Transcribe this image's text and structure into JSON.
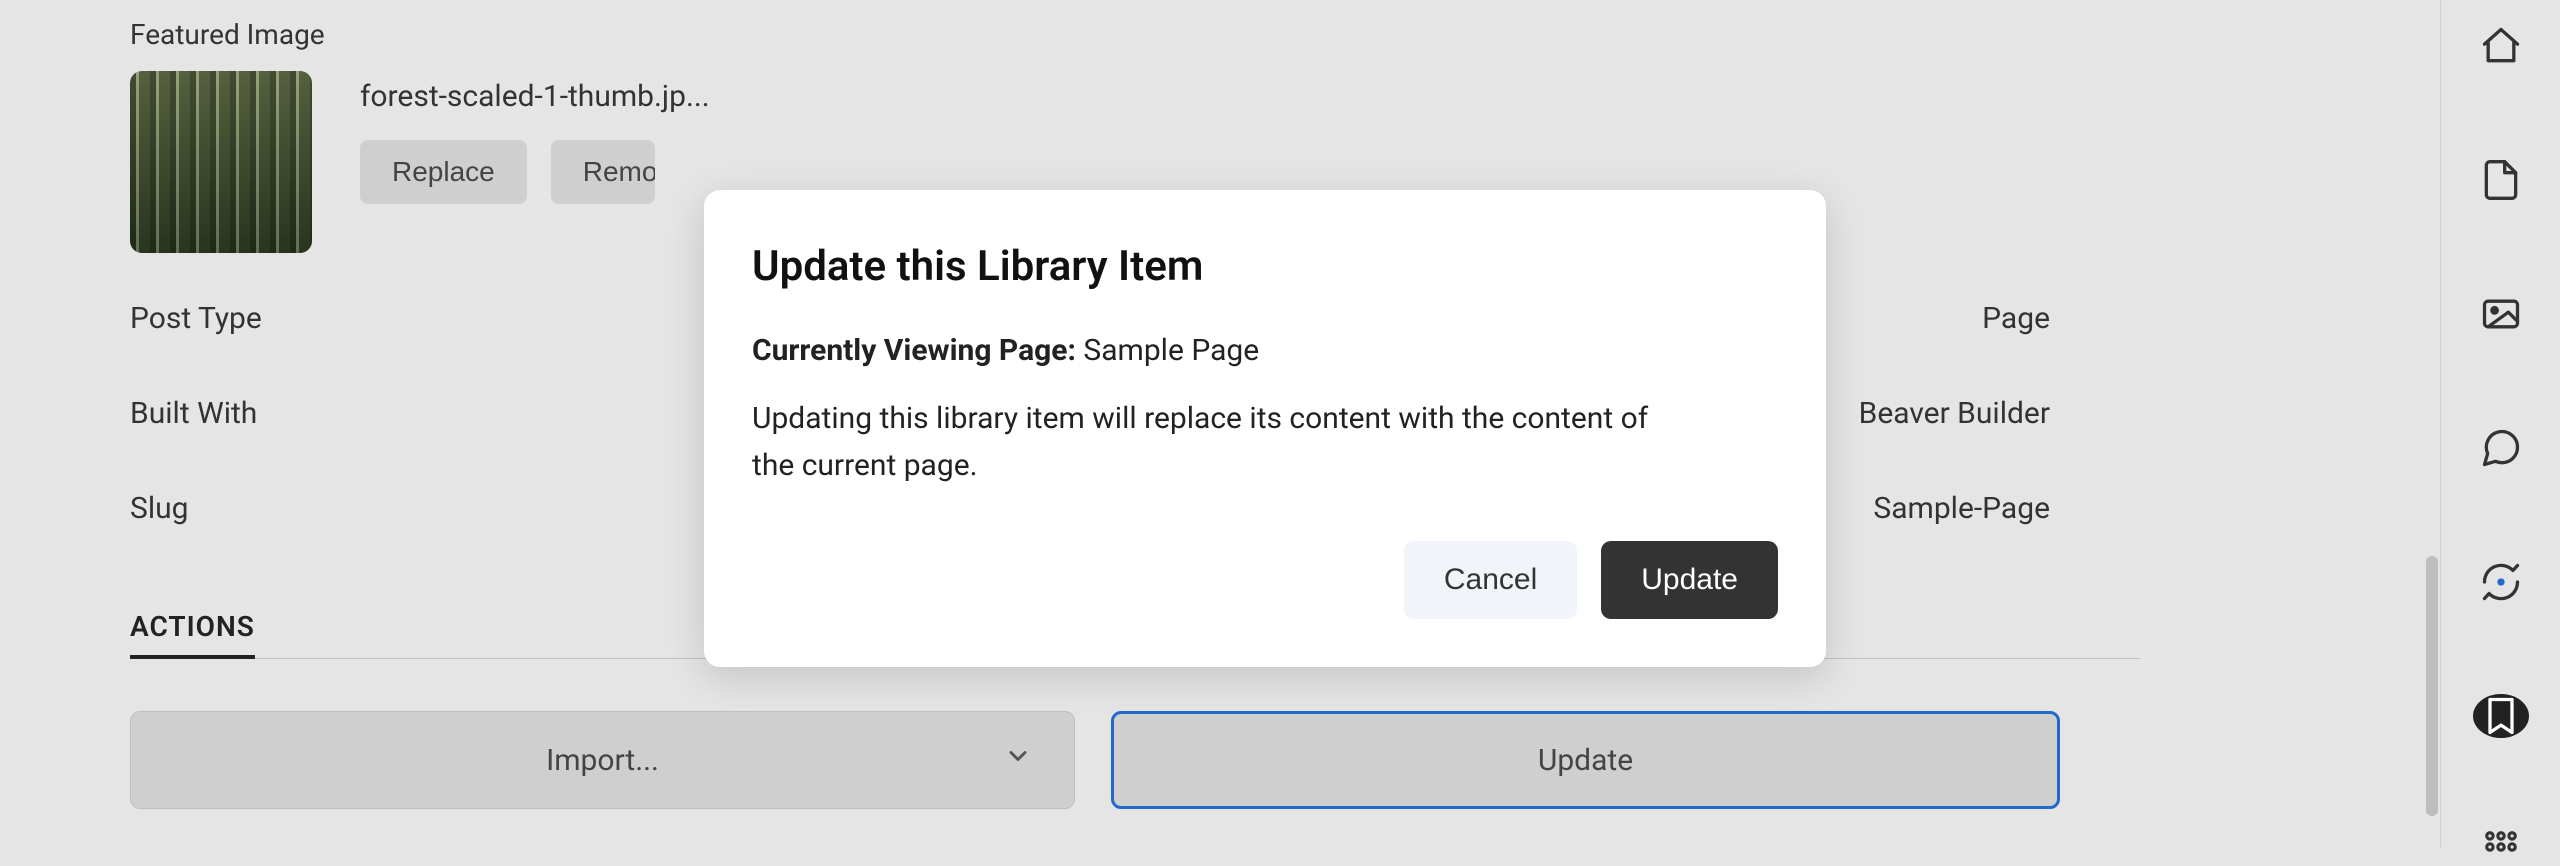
{
  "featured": {
    "section_label": "Featured Image",
    "filename": "forest-scaled-1-thumb.jp...",
    "replace_label": "Replace",
    "remove_label": "Remove"
  },
  "meta": {
    "post_type_label": "Post Type",
    "post_type_value": "Page",
    "built_with_label": "Built With",
    "built_with_value": "Beaver Builder",
    "slug_label": "Slug",
    "slug_value": "Sample-Page"
  },
  "actions": {
    "header": "ACTIONS",
    "import_label": "Import...",
    "update_label": "Update"
  },
  "modal": {
    "title": "Update this Library Item",
    "viewing_label": "Currently Viewing Page:",
    "viewing_value": "Sample Page",
    "body": "Updating this library item will replace its content with the content of the current page.",
    "cancel_label": "Cancel",
    "update_label": "Update"
  },
  "sidebar_icons": [
    "home-icon",
    "page-icon",
    "image-icon",
    "comment-icon",
    "sync-icon",
    "library-icon",
    "apps-icon"
  ]
}
